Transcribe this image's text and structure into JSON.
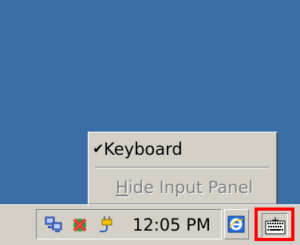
{
  "taskbar": {
    "clock": "12:05 PM",
    "tray_icons": [
      "network-icon",
      "activesync-icon",
      "power-plug-icon"
    ],
    "ie_icon": "internet-explorer-icon",
    "sip_icon": "keyboard-icon"
  },
  "input_menu": {
    "items": [
      {
        "label": "Keyboard",
        "checked": true,
        "enabled": true
      },
      {
        "label_accel": "H",
        "label_rest": "ide Input Panel",
        "enabled": false
      }
    ]
  },
  "colors": {
    "desktop": "#3a6ea5",
    "chrome": "#d4d0c8",
    "highlight_box": "#ff0000"
  }
}
